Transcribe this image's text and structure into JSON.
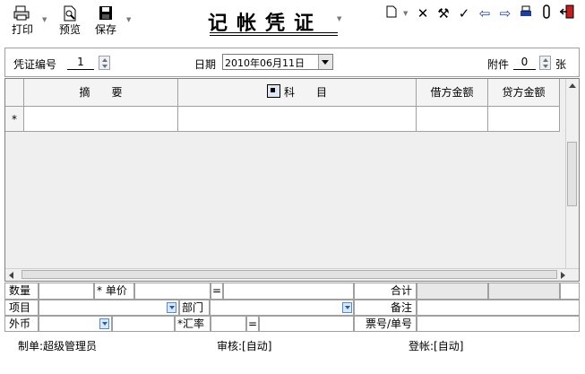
{
  "toolbar": {
    "print_label": "打印",
    "preview_label": "预览",
    "save_label": "保存"
  },
  "voucher": {
    "title": "记帐凭证",
    "number_label": "凭证编号",
    "number_value": "1",
    "date_label": "日期",
    "date_value": "2010年06月11日",
    "attachments_label": "附件",
    "attachments_value": "0",
    "attachments_unit": "张"
  },
  "grid": {
    "columns": [
      "摘　　要",
      "科　　目",
      "借方金额",
      "贷方金额"
    ],
    "row_marker": "*"
  },
  "footer_fields": {
    "quantity_label": "数量",
    "unit_price_label": "* 单价",
    "equals": "=",
    "total_label": "合计",
    "project_label": "项目",
    "department_label": "部门",
    "remark_label": "备注",
    "foreign_currency_label": "外币",
    "exchange_rate_label": "*汇率",
    "ticket_label": "票号/单号"
  },
  "status": {
    "maker": "制单:超级管理员",
    "reviewer": "审核:[自动]",
    "poster": "登帐:[自动]"
  },
  "colors": {
    "grid_background": "#efefef",
    "header_background": "#f4f4f4",
    "total_cell": "#e8e8e8"
  }
}
